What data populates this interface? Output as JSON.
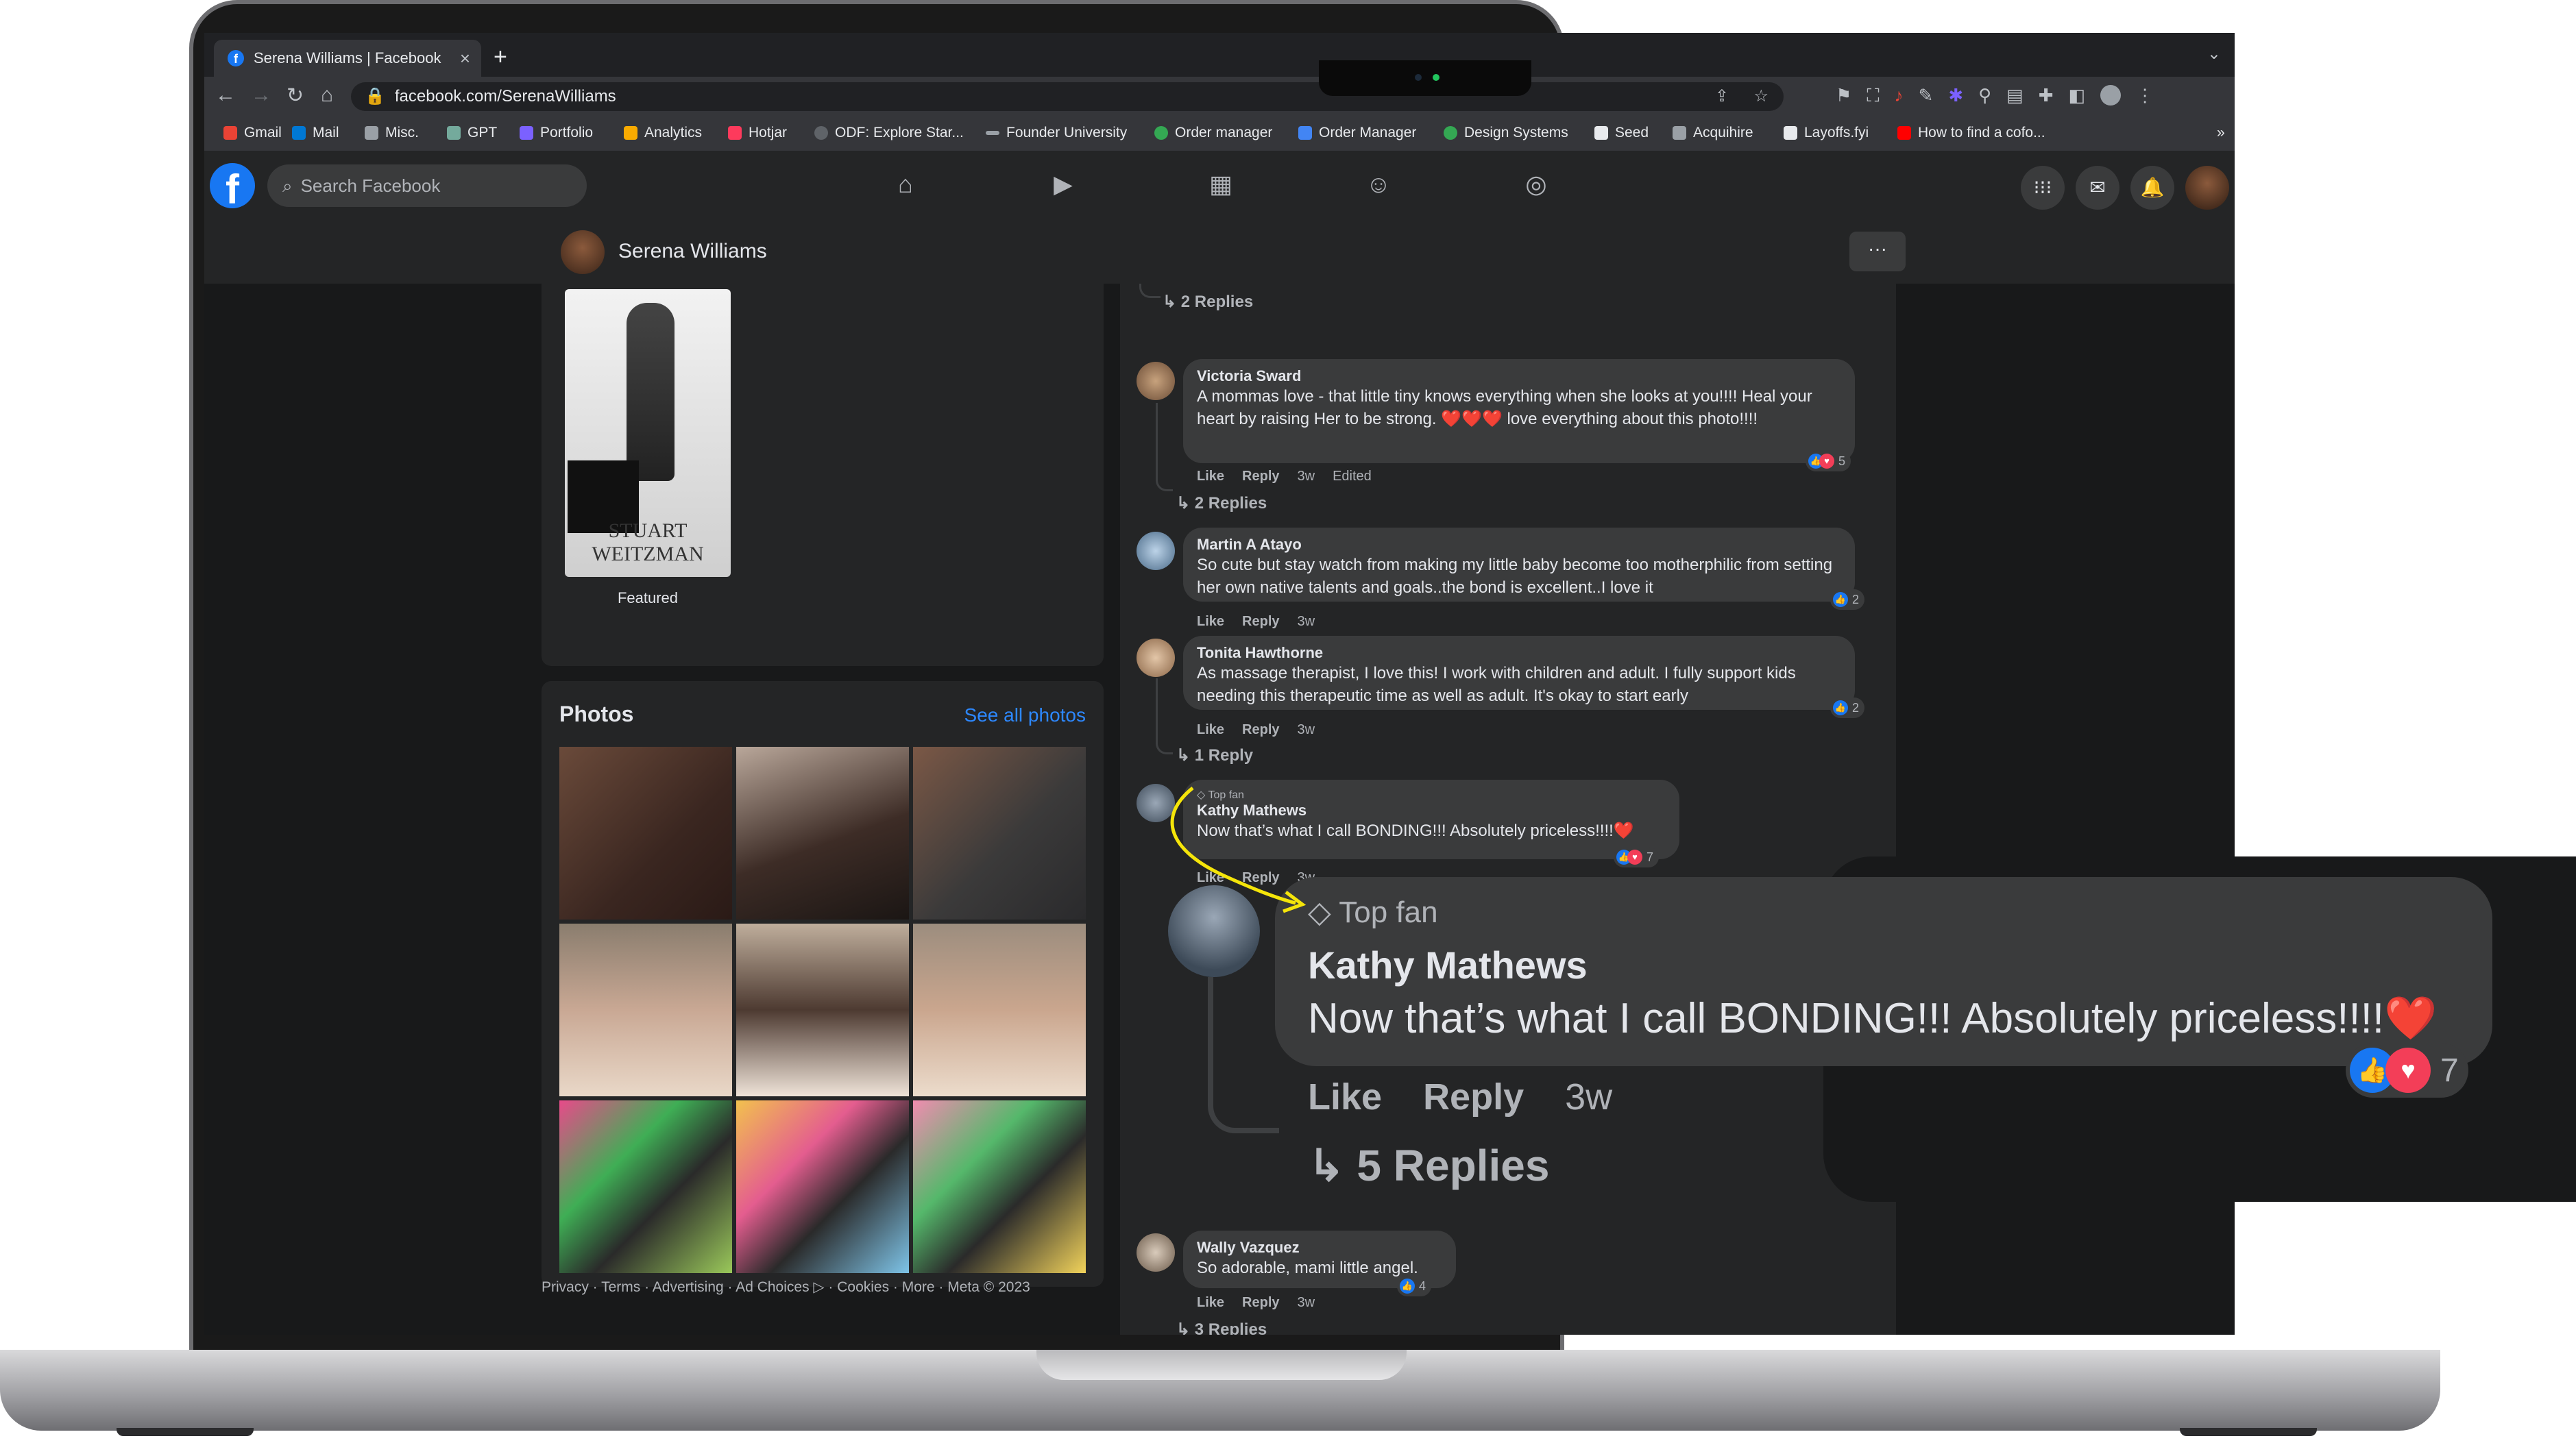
{
  "browser": {
    "tab_title": "Serena Williams | Facebook",
    "tab_close": "×",
    "new_tab": "+",
    "url": "facebook.com/SerenaWilliams",
    "bookmarks": [
      {
        "label": "Gmail",
        "color": "#ea4335"
      },
      {
        "label": "Mail",
        "color": "#0078d4"
      },
      {
        "label": "Misc.",
        "color": "#9aa0a6"
      },
      {
        "label": "GPT",
        "color": "#74aa9c"
      },
      {
        "label": "Portfolio",
        "color": "#7b61ff"
      },
      {
        "label": "Analytics",
        "color": "#f9ab00"
      },
      {
        "label": "Hotjar",
        "color": "#fd3a5c"
      },
      {
        "label": "ODF: Explore Star...",
        "color": "#5f6368"
      },
      {
        "label": "Founder University",
        "color": "#9aa0a6"
      },
      {
        "label": "Order manager",
        "color": "#34a853"
      },
      {
        "label": "Order Manager",
        "color": "#4285f4"
      },
      {
        "label": "Design Systems",
        "color": "#34a853"
      },
      {
        "label": "Seed",
        "color": "#e8eaed"
      },
      {
        "label": "Acquihire",
        "color": "#9aa0a6"
      },
      {
        "label": "Layoffs.fyi",
        "color": "#e8eaed"
      },
      {
        "label": "How to find a cofo...",
        "color": "#ff0000"
      }
    ],
    "bookmarks_more": "»"
  },
  "facebook": {
    "logo": "f",
    "search_placeholder": "Search Facebook",
    "nav_icons": [
      "home-icon",
      "watch-icon",
      "marketplace-icon",
      "groups-icon",
      "gaming-icon"
    ],
    "page_name": "Serena Williams",
    "more_label": "···",
    "featured_label": "Featured",
    "featured_brand": "STUART WEITZMAN",
    "photos_title": "Photos",
    "see_all": "See all photos",
    "footer": "Privacy · Terms · Advertising · Ad Choices ▷ · Cookies · More · Meta © 2023",
    "accent": "#1877f2"
  },
  "comments": [
    {
      "replies": "2 Replies"
    },
    {
      "author": "Victoria Sward",
      "text": "A mommas love - that little tiny knows everything when she looks at you!!!! Heal your heart by raising Her to be strong. ❤️❤️❤️ love everything about this photo!!!!",
      "like": "Like",
      "reply": "Reply",
      "time": "3w",
      "edited": "Edited",
      "reactions": "5",
      "replies": "2 Replies"
    },
    {
      "author": "Martin A Atayo",
      "text": "So cute but stay watch from making my little baby become too motherphilic from setting her own native talents and goals..the bond is excellent..I love it",
      "like": "Like",
      "reply": "Reply",
      "time": "3w",
      "reactions": "2"
    },
    {
      "author": "Tonita Hawthorne",
      "text": "As massage therapist, I love this! I work with children and adult. I fully support kids needing this therapeutic time as well as adult. It's okay to start early",
      "like": "Like",
      "reply": "Reply",
      "time": "3w",
      "reactions": "2",
      "replies": "1 Reply"
    },
    {
      "badge": "Top fan",
      "author": "Kathy Mathews",
      "text": "Now that’s what I call BONDING!!! Absolutely priceless!!!!❤️",
      "like": "Like",
      "reply": "Reply",
      "time": "3w",
      "reactions": "7"
    },
    {
      "author": "Wally Vazquez",
      "text": "So adorable, mami little angel.",
      "like": "Like",
      "reply": "Reply",
      "time": "3w",
      "reactions": "4",
      "replies": "3 Replies"
    }
  ],
  "zoom": {
    "badge": "Top fan",
    "author": "Kathy Mathews",
    "text": "Now that’s what I call BONDING!!! Absolutely priceless!!!!❤️",
    "like": "Like",
    "reply": "Reply",
    "time": "3w",
    "reactions": "7",
    "replies": "5 Replies"
  }
}
